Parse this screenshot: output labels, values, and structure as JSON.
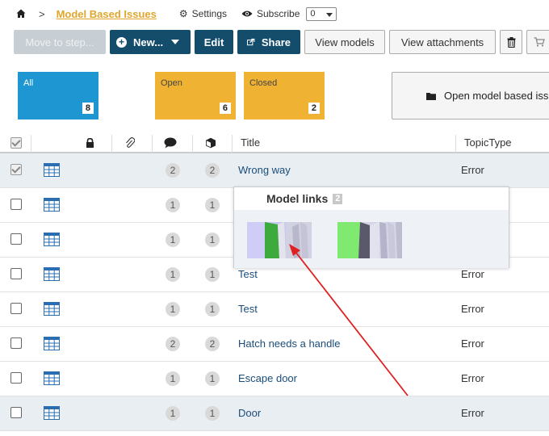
{
  "breadcrumb": {
    "separator": ">",
    "title": "Model Based Issues",
    "settings_label": "Settings",
    "subscribe_label": "Subscribe",
    "subscribe_value": "0"
  },
  "toolbar": {
    "move_label": "Move to step...",
    "new_label": "New...",
    "edit_label": "Edit",
    "share_label": "Share",
    "view_models_label": "View models",
    "view_attachments_label": "View attachments"
  },
  "tiles": {
    "all": {
      "label": "All",
      "count": "8"
    },
    "open": {
      "label": "Open",
      "count": "6"
    },
    "closed": {
      "label": "Closed",
      "count": "2"
    },
    "open_model_based": "Open model based iss"
  },
  "table": {
    "headers": {
      "title": "Title",
      "topic_type": "TopicType"
    },
    "rows": [
      {
        "comments": "2",
        "models": "2",
        "title": "Wrong way",
        "type": "Error",
        "checked": true
      },
      {
        "comments": "1",
        "models": "1",
        "title": "",
        "type": "",
        "checked": false
      },
      {
        "comments": "1",
        "models": "1",
        "title": "",
        "type": "",
        "checked": false
      },
      {
        "comments": "1",
        "models": "1",
        "title": "Test",
        "type": "Error",
        "checked": false
      },
      {
        "comments": "1",
        "models": "1",
        "title": "Test",
        "type": "Error",
        "checked": false
      },
      {
        "comments": "2",
        "models": "2",
        "title": "Hatch needs a handle",
        "type": "Error",
        "checked": false
      },
      {
        "comments": "1",
        "models": "1",
        "title": "Escape door",
        "type": "Error",
        "checked": false
      },
      {
        "comments": "1",
        "models": "1",
        "title": "Door",
        "type": "Error",
        "checked": false
      }
    ]
  },
  "popup": {
    "title": "Model links",
    "count": "2"
  },
  "colors": {
    "accent_dark": "#134d6b",
    "tile_blue": "#1e96d1",
    "tile_orange": "#f0b232",
    "link_blue": "#1a4d7a",
    "annotation_arrow": "#e02020"
  }
}
